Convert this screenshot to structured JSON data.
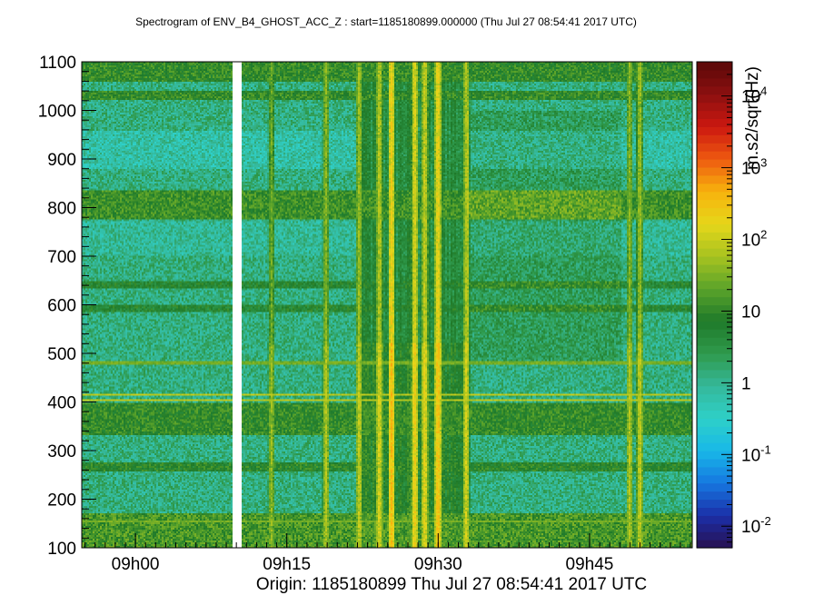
{
  "chart_data": {
    "type": "heatmap",
    "title": "Spectrogram of ENV_B4_GHOST_ACC_Z : start=1185180899.000000 (Thu Jul 27 08:54:41 2017 UTC)",
    "xlabel": "Origin: 1185180899  Thu Jul 27 08:54:41 2017 UTC",
    "ylabel": "",
    "colorbar_label": "m.s2/sqrt(Hz)",
    "x_unit": "minutes since 08:54:41 UTC",
    "xlim": [
      0,
      60.5
    ],
    "ylim": [
      100,
      1100
    ],
    "x_ticks": [
      {
        "value": 5.32,
        "label": "09h00"
      },
      {
        "value": 20.32,
        "label": "09h15"
      },
      {
        "value": 35.32,
        "label": "09h30"
      },
      {
        "value": 50.32,
        "label": "09h45"
      }
    ],
    "y_ticks": [
      {
        "value": 100,
        "label": "100"
      },
      {
        "value": 200,
        "label": "200"
      },
      {
        "value": 300,
        "label": "300"
      },
      {
        "value": 400,
        "label": "400"
      },
      {
        "value": 500,
        "label": "500"
      },
      {
        "value": 600,
        "label": "600"
      },
      {
        "value": 700,
        "label": "700"
      },
      {
        "value": 800,
        "label": "800"
      },
      {
        "value": 900,
        "label": "900"
      },
      {
        "value": 1000,
        "label": "1000"
      },
      {
        "value": 1100,
        "label": "1100"
      }
    ],
    "color_scale": "log",
    "color_range": [
      0.005,
      30000
    ],
    "colorbar_ticks": [
      {
        "value": 0.01,
        "base": "10",
        "exp": "-2"
      },
      {
        "value": 0.1,
        "base": "10",
        "exp": "-1"
      },
      {
        "value": 1,
        "base": "1",
        "exp": ""
      },
      {
        "value": 10,
        "base": "10",
        "exp": ""
      },
      {
        "value": 100,
        "base": "10",
        "exp": "2"
      },
      {
        "value": 1000,
        "base": "10",
        "exp": "3"
      },
      {
        "value": 10000,
        "base": "10",
        "exp": "4"
      }
    ],
    "colormap": [
      "#281050",
      "#1b2fa8",
      "#1677e0",
      "#18b8e8",
      "#2ed0c8",
      "#35b89a",
      "#2f9a4c",
      "#1f7a2a",
      "#5aa32a",
      "#a7c320",
      "#e6d61a",
      "#f7b30d",
      "#ee5a10",
      "#cc1810",
      "#8c1010",
      "#5a0808"
    ],
    "data_gap": {
      "x_start": 15.0,
      "x_end": 15.8
    },
    "horizontal_lines": [
      {
        "y_hz": 155,
        "level": 30
      },
      {
        "y_hz": 405,
        "level": 80
      },
      {
        "y_hz": 415,
        "level": 80
      },
      {
        "y_hz": 480,
        "level": 30
      }
    ],
    "frequency_bands": [
      {
        "y_from": 100,
        "y_to": 170,
        "level": 15
      },
      {
        "y_from": 255,
        "y_to": 275,
        "level": 8
      },
      {
        "y_from": 330,
        "y_to": 400,
        "level": 10
      },
      {
        "y_from": 585,
        "y_to": 600,
        "level": 6
      },
      {
        "y_from": 635,
        "y_to": 650,
        "level": 6
      },
      {
        "y_from": 775,
        "y_to": 835,
        "level": 12
      },
      {
        "y_from": 1020,
        "y_to": 1040,
        "level": 10
      },
      {
        "y_from": 1060,
        "y_to": 1100,
        "level": 10
      }
    ],
    "vertical_events": [
      {
        "x": 18.8,
        "level": 40
      },
      {
        "x": 24.2,
        "level": 60
      },
      {
        "x": 27.5,
        "level": 80
      },
      {
        "x": 29.5,
        "level": 120
      },
      {
        "x": 30.7,
        "level": 300
      },
      {
        "x": 33.0,
        "level": 200
      },
      {
        "x": 34.0,
        "level": 150
      },
      {
        "x": 35.3,
        "level": 300
      },
      {
        "x": 38.1,
        "level": 100
      },
      {
        "x": 54.3,
        "level": 60
      },
      {
        "x": 55.3,
        "level": 80
      }
    ],
    "broadband_regions": [
      {
        "x_from": 27.5,
        "x_to": 38.0,
        "level": 30
      }
    ]
  }
}
